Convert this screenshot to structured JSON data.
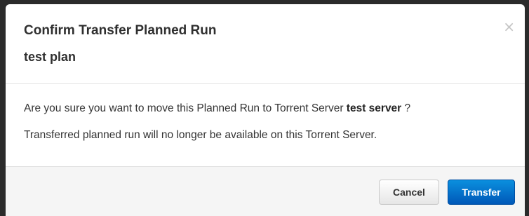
{
  "dialog": {
    "title": "Confirm Transfer Planned Run",
    "subtitle": "test plan",
    "close_glyph": "×",
    "message_prefix": "Are you sure you want to move this Planned Run to Torrent Server ",
    "server_name": "test server",
    "message_suffix": " ?",
    "warning": "Transferred planned run will no longer be available on this Torrent Server.",
    "cancel_label": "Cancel",
    "transfer_label": "Transfer"
  },
  "colors": {
    "primary_button": "#0a6fd0",
    "backdrop": "#2b2b2b"
  }
}
